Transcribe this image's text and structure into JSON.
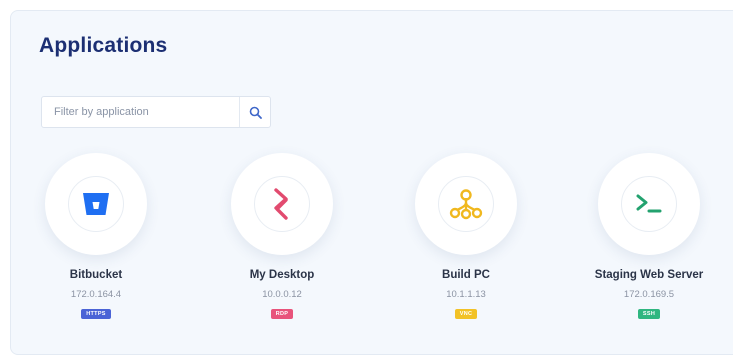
{
  "header": {
    "title": "Applications"
  },
  "filter": {
    "placeholder": "Filter by application"
  },
  "apps": [
    {
      "name": "Bitbucket",
      "ip": "172.0.164.4",
      "protocol": "HTTPS",
      "badge_color": "#4a63d6",
      "icon": "bitbucket-icon",
      "icon_color": "#1f6ff2"
    },
    {
      "name": "My Desktop",
      "ip": "10.0.0.12",
      "protocol": "RDP",
      "badge_color": "#e8537b",
      "icon": "desktop-chevron-icon",
      "icon_color": "#e24b6f"
    },
    {
      "name": "Build PC",
      "ip": "10.1.1.13",
      "protocol": "VNC",
      "badge_color": "#f2c227",
      "icon": "network-tree-icon",
      "icon_color": "#f0b81f"
    },
    {
      "name": "Staging Web Server",
      "ip": "172.0.169.5",
      "protocol": "SSH",
      "badge_color": "#2fb680",
      "icon": "terminal-icon",
      "icon_color": "#23a26f"
    }
  ]
}
